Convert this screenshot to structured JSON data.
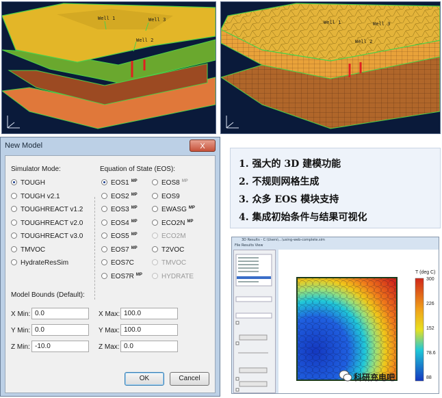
{
  "top_left_view": {
    "well_labels": [
      "Well 1",
      "Well 3",
      "Well 2"
    ]
  },
  "top_right_view": {
    "well_labels": [
      "Well 1",
      "Well 3",
      "Well 2"
    ]
  },
  "dialog": {
    "title": "New Model",
    "close_label": "X",
    "simulator_mode_label": "Simulator Mode:",
    "simulator_modes": [
      {
        "label": "TOUGH",
        "selected": true
      },
      {
        "label": "TOUGH v2.1",
        "selected": false
      },
      {
        "label": "TOUGHREACT v1.2",
        "selected": false
      },
      {
        "label": "TOUGHREACT v2.0",
        "selected": false
      },
      {
        "label": "TOUGHREACT v3.0",
        "selected": false
      },
      {
        "label": "TMVOC",
        "selected": false
      },
      {
        "label": "HydrateResSim",
        "selected": false
      }
    ],
    "eos_label": "Equation of State (EOS):",
    "eos_col1": [
      {
        "label": "EOS1",
        "mp": "MP",
        "selected": true,
        "disabled": false
      },
      {
        "label": "EOS2",
        "mp": "MP",
        "selected": false,
        "disabled": false
      },
      {
        "label": "EOS3",
        "mp": "MP",
        "selected": false,
        "disabled": false
      },
      {
        "label": "EOS4",
        "mp": "MP",
        "selected": false,
        "disabled": false
      },
      {
        "label": "EOS5",
        "mp": "MP",
        "selected": false,
        "disabled": false
      },
      {
        "label": "EOS7",
        "mp": "MP",
        "selected": false,
        "disabled": false
      },
      {
        "label": "EOS7C",
        "mp": "",
        "selected": false,
        "disabled": false
      },
      {
        "label": "EOS7R",
        "mp": "MP",
        "selected": false,
        "disabled": false
      }
    ],
    "eos_col2": [
      {
        "label": "EOS8",
        "mp": "MP",
        "selected": false,
        "disabled": false
      },
      {
        "label": "EOS9",
        "mp": "",
        "selected": false,
        "disabled": false
      },
      {
        "label": "EWASG",
        "mp": "MP",
        "selected": false,
        "disabled": false
      },
      {
        "label": "ECO2N",
        "mp": "MP",
        "selected": false,
        "disabled": false
      },
      {
        "label": "ECO2M",
        "mp": "",
        "selected": false,
        "disabled": true
      },
      {
        "label": "T2VOC",
        "mp": "",
        "selected": false,
        "disabled": false
      },
      {
        "label": "TMVOC",
        "mp": "",
        "selected": false,
        "disabled": true
      },
      {
        "label": "HYDRATE",
        "mp": "",
        "selected": false,
        "disabled": true
      }
    ],
    "bounds_label": "Model Bounds (Default):",
    "bounds": {
      "x_min_label": "X Min:",
      "x_min": "0.0",
      "x_max_label": "X Max:",
      "x_max": "100.0",
      "y_min_label": "Y Min:",
      "y_min": "0.0",
      "y_max_label": "Y Max:",
      "y_max": "100.0",
      "z_min_label": "Z Min:",
      "z_min": "-10.0",
      "z_max_label": "Z Max:",
      "z_max": "0.0"
    },
    "ok_label": "OK",
    "cancel_label": "Cancel"
  },
  "features": [
    "1.  强大的 3D 建模功能",
    "2.  不规则网格生成",
    "3.  众多 EOS 模块支持",
    "4.  集成初始条件与结果可视化"
  ],
  "results_window": {
    "title": "3D Results - C:\\Users\\...\\using-web-complete.sim",
    "menu": "File  Results  View",
    "colorbar_title": "T (deg C)",
    "colorbar_ticks": [
      "300",
      "226",
      "152",
      "78.6",
      "88"
    ],
    "colors": {
      "hot": "#d0281a",
      "mid": "#f0c81a",
      "cool": "#20c8d8",
      "cold": "#1438c0"
    },
    "watermark": "科研充电吧"
  }
}
